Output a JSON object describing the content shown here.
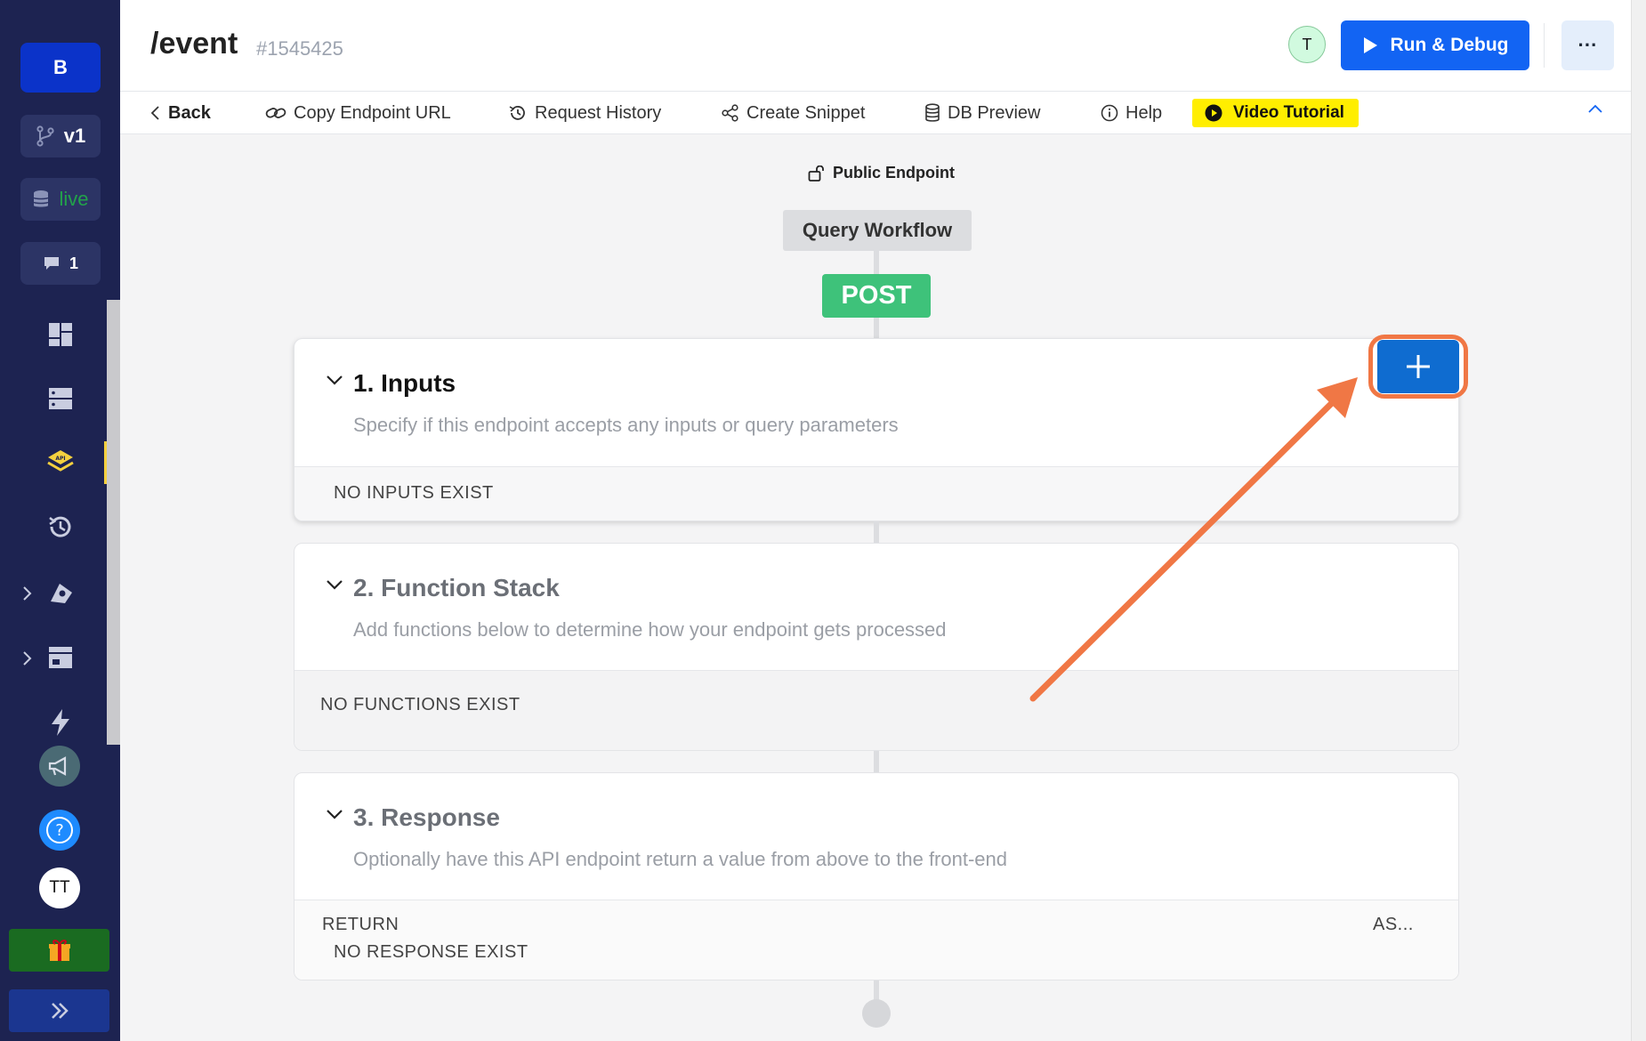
{
  "sidebar": {
    "brand_letter": "B",
    "branch": "v1",
    "datasource": "live",
    "comments_count": "1",
    "user_initials": "TT",
    "icons": [
      "dashboard-icon",
      "database-tables-icon",
      "api-icon",
      "history-icon",
      "addons-icon",
      "marketplace-icon",
      "lightning-icon",
      "announcement-icon",
      "help-icon",
      "gift-icon",
      "expand-icon"
    ]
  },
  "header": {
    "title": "/event",
    "id": "#1545425",
    "avatar_letter": "T",
    "run_label": "Run & Debug",
    "more_label": "···"
  },
  "toolbar": {
    "back": "Back",
    "copy_url": "Copy Endpoint URL",
    "history": "Request History",
    "snippet": "Create Snippet",
    "db_preview": "DB Preview",
    "help": "Help",
    "video": "Video Tutorial"
  },
  "workflow": {
    "public_label": "Public Endpoint",
    "type_label": "Query Workflow",
    "method": "POST",
    "sections": [
      {
        "title": "1. Inputs",
        "description": "Specify if this endpoint accepts any inputs or query parameters",
        "empty": "NO INPUTS EXIST"
      },
      {
        "title": "2. Function Stack",
        "description": "Add functions below to determine how your endpoint gets processed",
        "empty": "NO FUNCTIONS EXIST"
      },
      {
        "title": "3. Response",
        "description": "Optionally have this API endpoint return a value from above to the front-end",
        "return_label": "RETURN",
        "as_label": "AS...",
        "empty": "NO RESPONSE EXIST"
      }
    ]
  },
  "colors": {
    "sidebar_bg": "#1d2351",
    "primary": "#1264f3",
    "post_green": "#3ec27a",
    "annotation": "#f07745",
    "video_yellow": "#ffee00"
  }
}
